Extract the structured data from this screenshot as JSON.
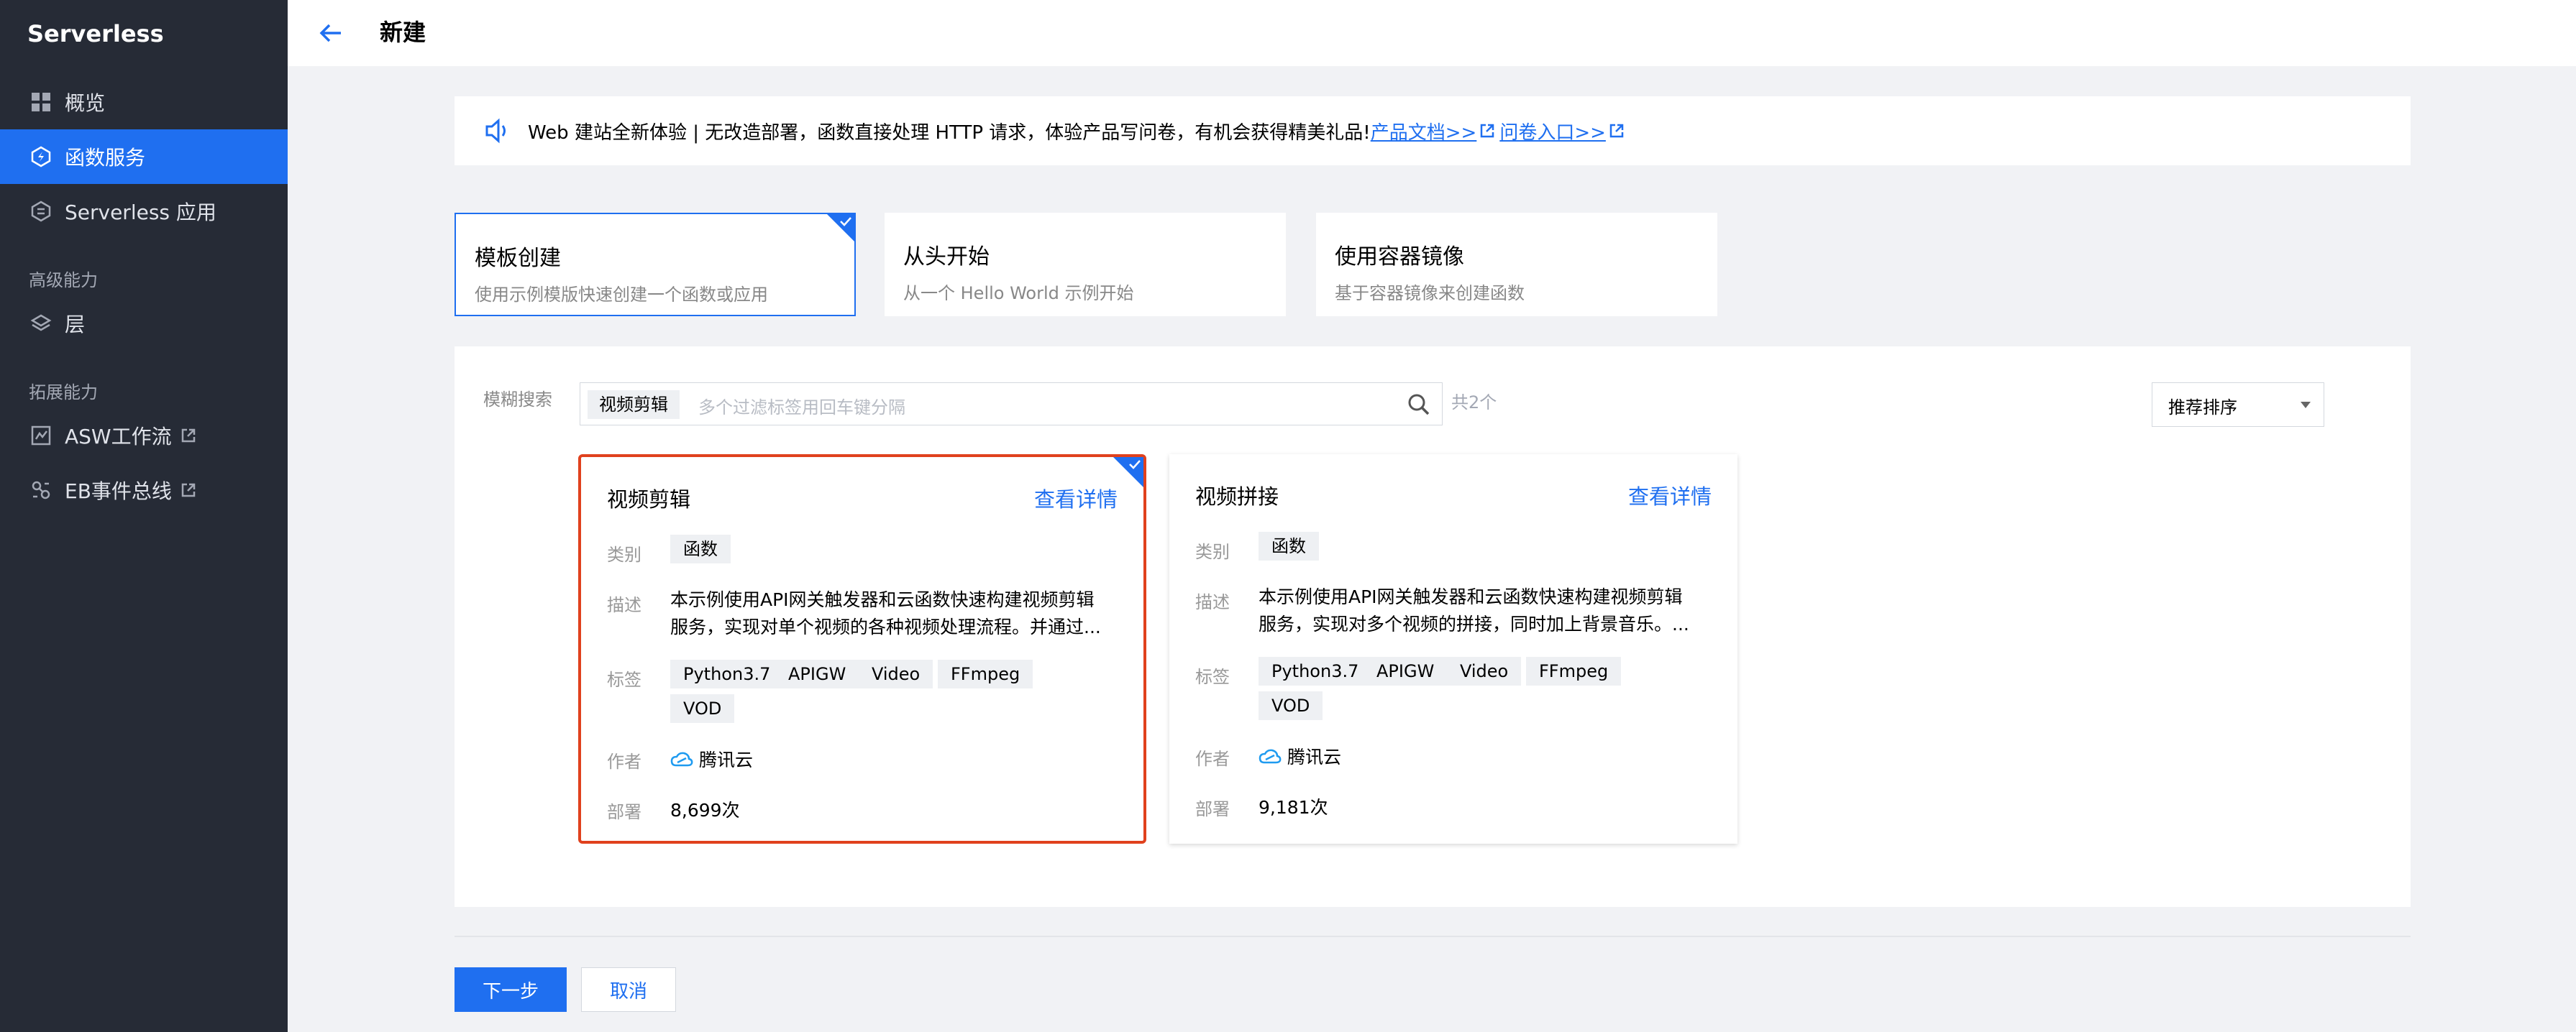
{
  "sidebar": {
    "brand": "Serverless",
    "items": [
      {
        "label": "概览",
        "icon": "grid-icon"
      },
      {
        "label": "函数服务",
        "icon": "function-icon",
        "active": true
      },
      {
        "label": "Serverless 应用",
        "icon": "hexagon-app-icon"
      }
    ],
    "sections": [
      {
        "label": "高级能力",
        "items": [
          {
            "label": "层",
            "icon": "layers-icon"
          }
        ]
      },
      {
        "label": "拓展能力",
        "items": [
          {
            "label": "ASW工作流",
            "icon": "workflow-icon",
            "external": true
          },
          {
            "label": "EB事件总线",
            "icon": "event-bus-icon",
            "external": true
          }
        ]
      }
    ]
  },
  "header": {
    "title": "新建"
  },
  "notice": {
    "text": "Web 建站全新体验 | 无改造部署，函数直接处理 HTTP 请求，体验产品写问卷，有机会获得精美礼品!",
    "link1": "产品文档>>",
    "link2": "问卷入口>>"
  },
  "modes": [
    {
      "title": "模板创建",
      "desc": "使用示例模版快速创建一个函数或应用",
      "selected": true
    },
    {
      "title": "从头开始",
      "desc": "从一个 Hello World 示例开始"
    },
    {
      "title": "使用容器镜像",
      "desc": "基于容器镜像来创建函数"
    }
  ],
  "search": {
    "label": "模糊搜索",
    "tag": "视频剪辑",
    "placeholder": "多个过滤标签用回车键分隔",
    "count": "共2个",
    "sort": "推荐排序"
  },
  "labels": {
    "category": "类别",
    "description": "描述",
    "tags": "标签",
    "author": "作者",
    "deploy": "部署"
  },
  "templates": [
    {
      "title": "视频剪辑",
      "link": "查看详情",
      "category": "函数",
      "description": "本示例使用API网关触发器和云函数快速构建视频剪辑服务，实现对单个视频的各种视频处理流程。并通过...",
      "tags": [
        "Python3.7",
        "APIGW",
        "Video",
        "FFmpeg",
        "VOD"
      ],
      "author": "腾讯云",
      "deploys": "8,699次",
      "selected": true
    },
    {
      "title": "视频拼接",
      "link": "查看详情",
      "category": "函数",
      "description": "本示例使用API网关触发器和云函数快速构建视频剪辑服务，实现对多个视频的拼接，同时加上背景音乐。...",
      "tags": [
        "Python3.7",
        "APIGW",
        "Video",
        "FFmpeg",
        "VOD"
      ],
      "author": "腾讯云",
      "deploys": "9,181次"
    }
  ],
  "footer": {
    "next": "下一步",
    "cancel": "取消"
  },
  "colors": {
    "sidebar_bg": "#262b36",
    "accent": "#1f6ff0",
    "selected_border": "#e0411d"
  }
}
